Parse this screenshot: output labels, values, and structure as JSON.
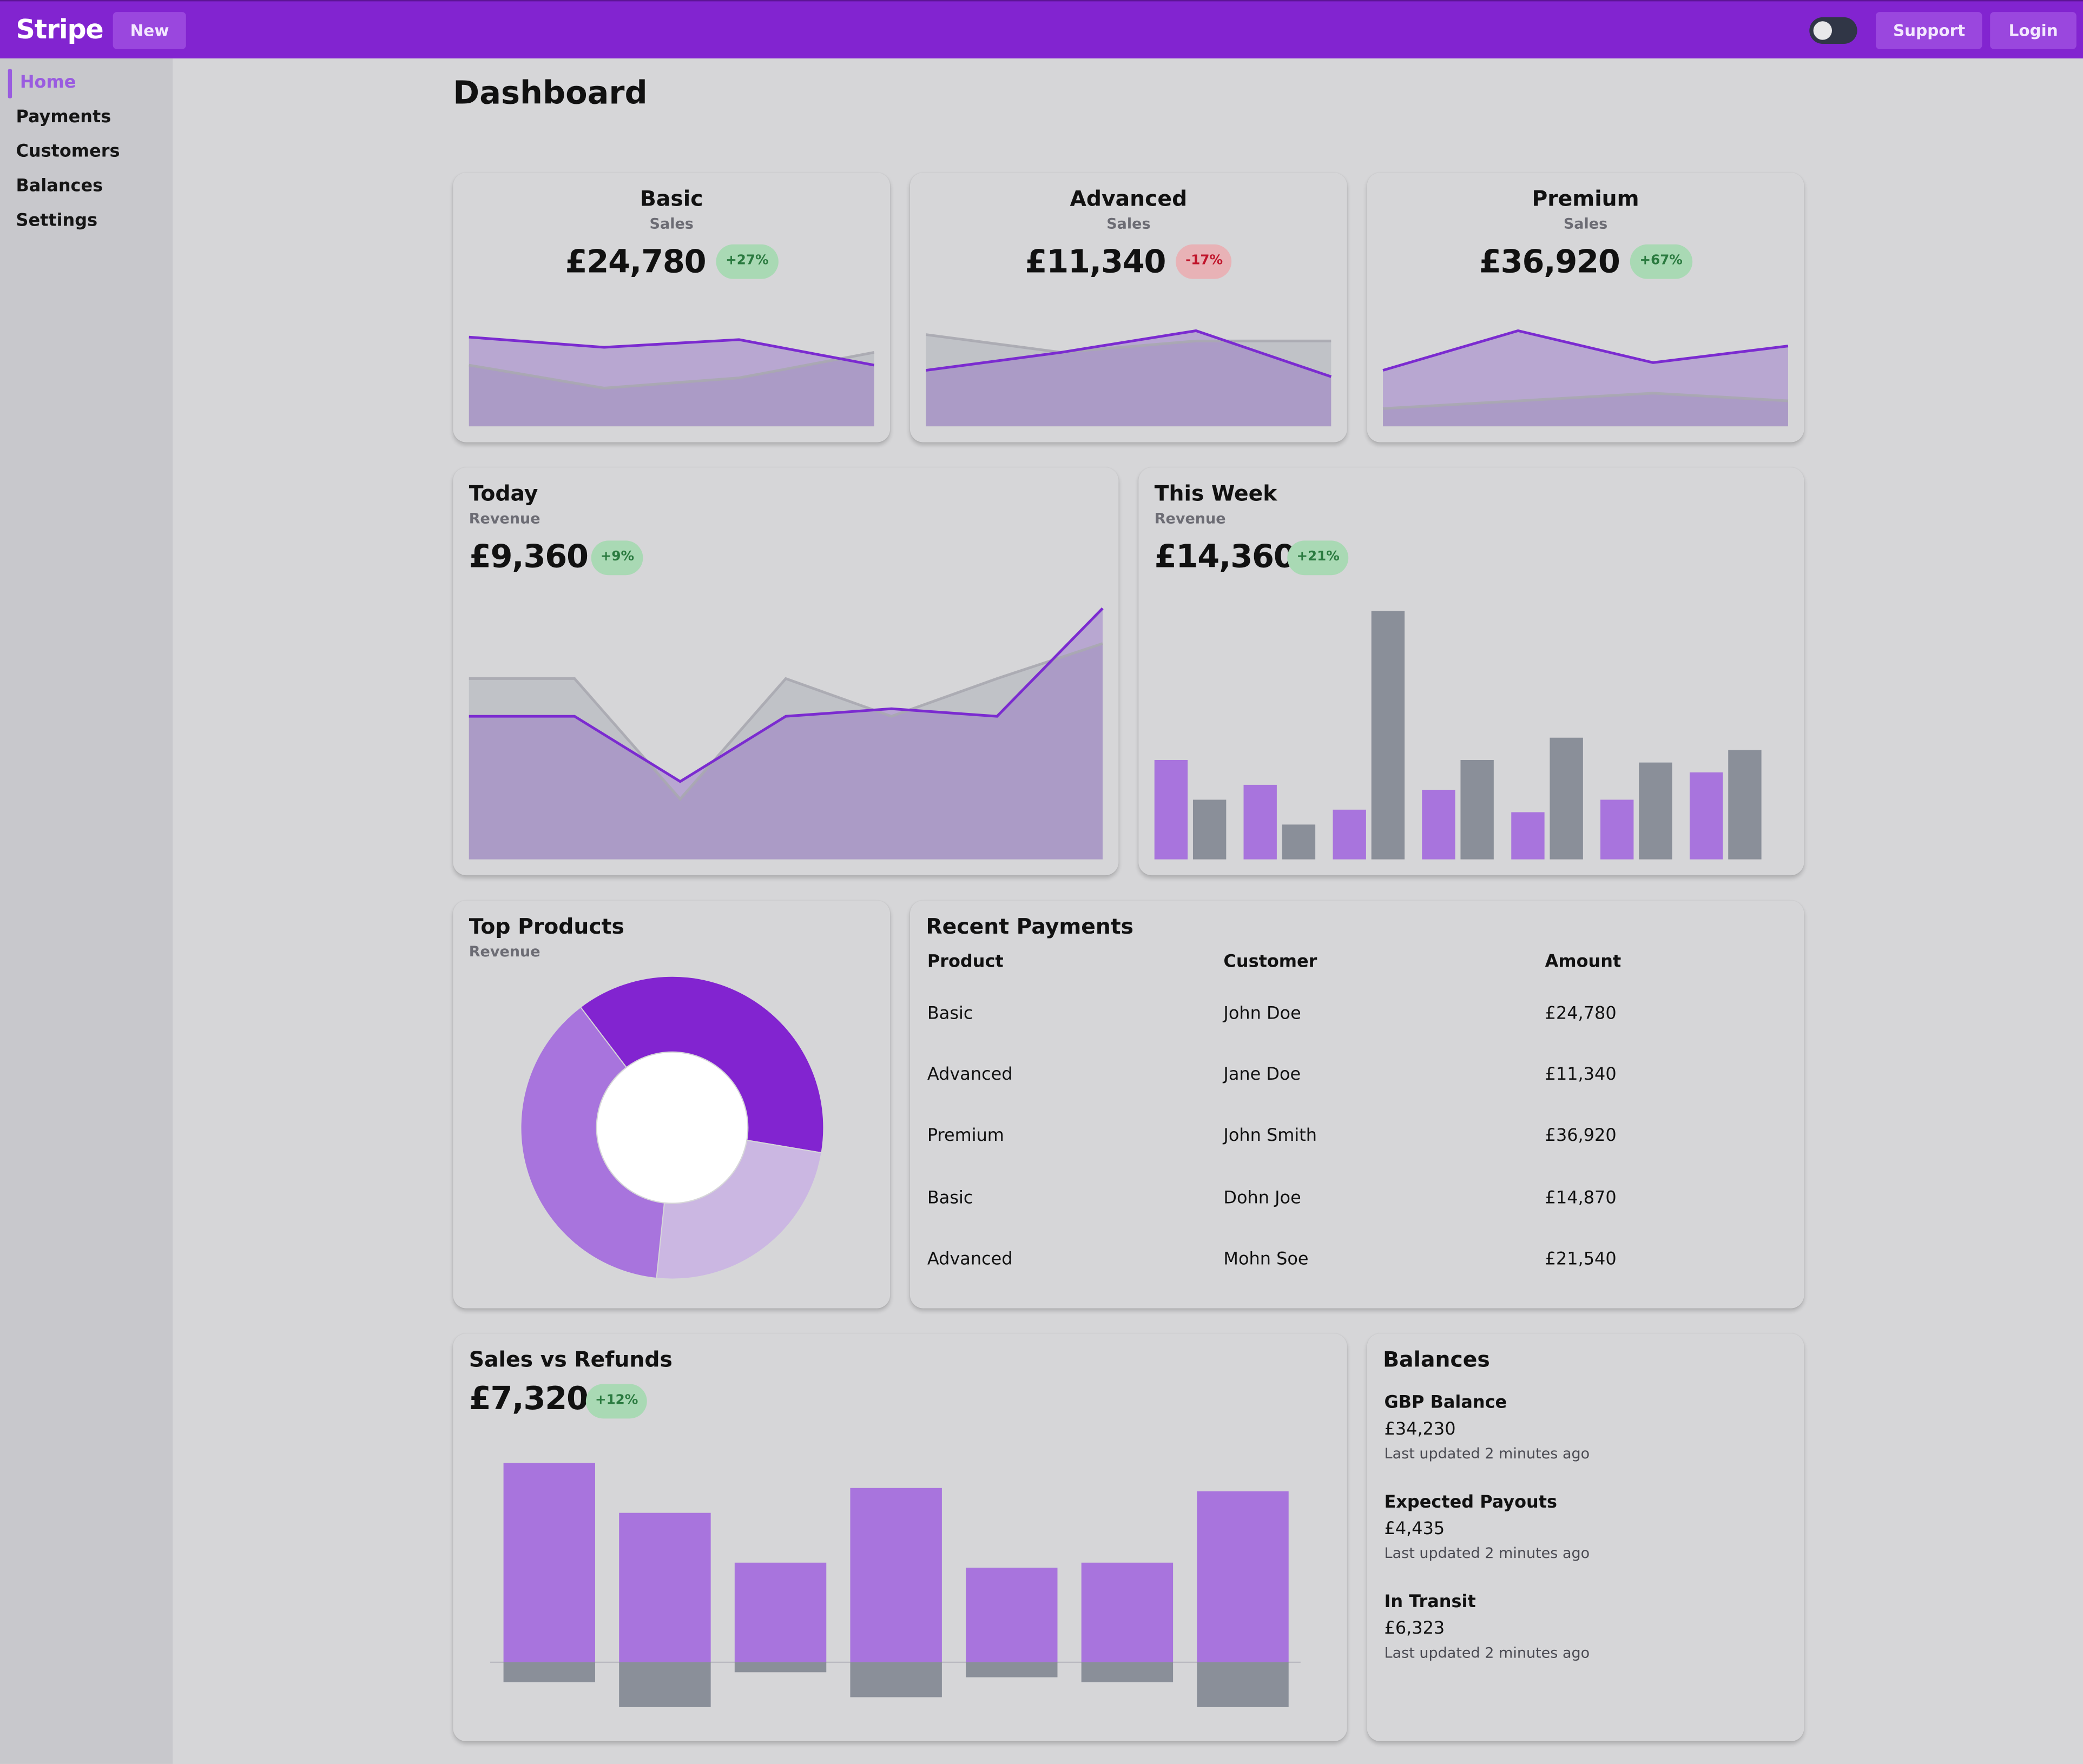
{
  "app": {
    "brand": "Stripe",
    "new_label": "New",
    "support_label": "Support",
    "login_label": "Login"
  },
  "sidebar": {
    "items": [
      "Home",
      "Payments",
      "Customers",
      "Balances",
      "Settings"
    ],
    "active": "Home"
  },
  "page": {
    "title": "Dashboard"
  },
  "colors": {
    "purple": "#7b2bd0",
    "purple_fill": "#b3a4cc",
    "gray": "#8a8f99",
    "bar_purple": "#a874dd",
    "topbar": "#8224d0"
  },
  "plans": [
    {
      "title": "Basic",
      "subtitle": "Sales",
      "value": "£24,780",
      "badge": "+27%",
      "trend": "up"
    },
    {
      "title": "Advanced",
      "subtitle": "Sales",
      "value": "£11,340",
      "badge": "-17%",
      "trend": "down"
    },
    {
      "title": "Premium",
      "subtitle": "Sales",
      "value": "£36,920",
      "badge": "+67%",
      "trend": "up"
    }
  ],
  "today": {
    "title": "Today",
    "subtitle": "Revenue",
    "value": "£9,360",
    "badge": "+9%"
  },
  "week": {
    "title": "This Week",
    "subtitle": "Revenue",
    "value": "£14,360",
    "badge": "+21%"
  },
  "top_products": {
    "title": "Top Products",
    "subtitle": "Revenue"
  },
  "recent_payments": {
    "title": "Recent Payments",
    "columns": [
      "Product",
      "Customer",
      "Amount"
    ],
    "rows": [
      [
        "Basic",
        "John Doe",
        "£24,780"
      ],
      [
        "Advanced",
        "Jane Doe",
        "£11,340"
      ],
      [
        "Premium",
        "John Smith",
        "£36,920"
      ],
      [
        "Basic",
        "Dohn Joe",
        "£14,870"
      ],
      [
        "Advanced",
        "Mohn Soe",
        "£21,540"
      ]
    ]
  },
  "sales_refunds": {
    "title": "Sales vs Refunds",
    "value": "£7,320",
    "badge": "+12%"
  },
  "balances": {
    "title": "Balances",
    "items": [
      {
        "label": "GBP Balance",
        "amount": "£34,230",
        "note": "Last updated 2 minutes ago"
      },
      {
        "label": "Expected Payouts",
        "amount": "£4,435",
        "note": "Last updated 2 minutes ago"
      },
      {
        "label": "In Transit",
        "amount": "£6,323",
        "note": "Last updated 2 minutes ago"
      }
    ]
  },
  "chart_data": [
    {
      "type": "area",
      "ylim": [
        0,
        100
      ],
      "series": [
        {
          "values": [
            70,
            62,
            68,
            48
          ]
        },
        {
          "values": [
            48,
            30,
            38,
            58
          ]
        }
      ]
    },
    {
      "type": "area",
      "ylim": [
        0,
        100
      ],
      "series": [
        {
          "values": [
            44,
            58,
            75,
            39
          ]
        },
        {
          "values": [
            72,
            58,
            67,
            67
          ]
        }
      ]
    },
    {
      "type": "area",
      "ylim": [
        0,
        100
      ],
      "series": [
        {
          "values": [
            44,
            75,
            50,
            63
          ]
        },
        {
          "values": [
            14,
            20,
            26,
            20
          ]
        }
      ]
    },
    {
      "type": "area",
      "ylim": [
        0,
        100
      ],
      "series": [
        {
          "values": [
            57,
            57,
            31,
            57,
            60,
            57,
            100
          ]
        },
        {
          "values": [
            72,
            72,
            24,
            72,
            57,
            72,
            86
          ]
        }
      ]
    },
    {
      "type": "bar",
      "ylim": [
        0,
        100
      ],
      "series": [
        {
          "values": [
            40,
            30,
            20,
            28,
            19,
            24,
            35
          ]
        },
        {
          "values": [
            24,
            14,
            100,
            40,
            49,
            39,
            44
          ]
        }
      ]
    },
    {
      "type": "pie",
      "values": [
        38,
        24,
        38
      ]
    },
    {
      "type": "bar",
      "ylim": [
        -30,
        130
      ],
      "series": [
        {
          "values": [
            120,
            90,
            60,
            105,
            57,
            60,
            103
          ]
        },
        {
          "values": [
            -12,
            -27,
            -6,
            -21,
            -9,
            -12,
            -27
          ]
        }
      ]
    }
  ]
}
